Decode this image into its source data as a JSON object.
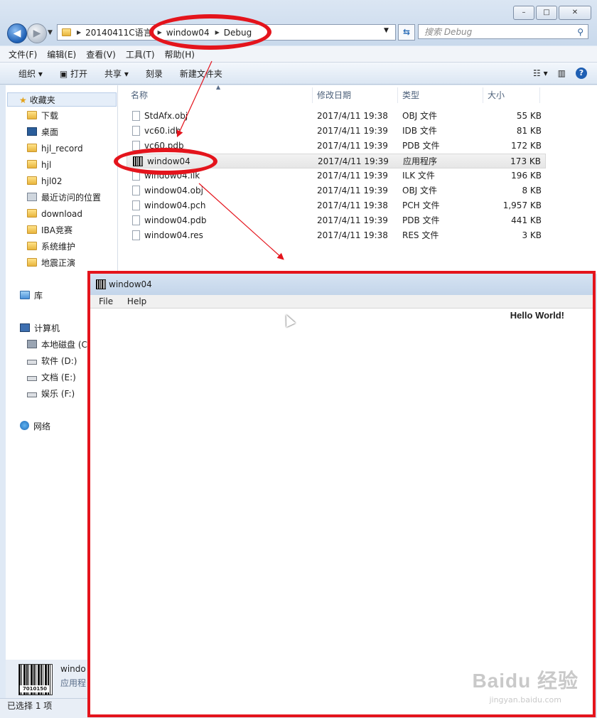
{
  "window": {
    "controls": [
      "–",
      "□",
      "✕"
    ]
  },
  "address": {
    "segments": [
      "20140411C语言",
      "window04",
      "Debug"
    ],
    "search_placeholder": "搜索 Debug"
  },
  "menu": [
    "文件(F)",
    "编辑(E)",
    "查看(V)",
    "工具(T)",
    "帮助(H)"
  ],
  "toolbar": {
    "organize": "组织 ▾",
    "open": "打开",
    "share": "共享 ▾",
    "burn": "刻录",
    "new_folder": "新建文件夹"
  },
  "nav": {
    "favorites": "收藏夹",
    "fav_items": [
      "下载",
      "桌面",
      "hjl_record",
      "hjl",
      "hjl02",
      "最近访问的位置",
      "download",
      "IBA竞赛",
      "系统维护",
      "地震正演"
    ],
    "library": "库",
    "computer": "计算机",
    "drives": [
      "本地磁盘 (C",
      "软件 (D:)",
      "文档 (E:)",
      "娱乐 (F:)"
    ],
    "network": "网络"
  },
  "columns": {
    "name": "名称",
    "date": "修改日期",
    "type": "类型",
    "size": "大小"
  },
  "files": [
    {
      "name": "StdAfx.obj",
      "date": "2017/4/11 19:38",
      "type": "OBJ 文件",
      "size": "55 KB",
      "icon": "document-icon"
    },
    {
      "name": "vc60.idb",
      "date": "2017/4/11 19:39",
      "type": "IDB 文件",
      "size": "81 KB",
      "icon": "document-icon"
    },
    {
      "name": "vc60.pdb",
      "date": "2017/4/11 19:39",
      "type": "PDB 文件",
      "size": "172 KB",
      "icon": "document-icon"
    },
    {
      "name": "window04",
      "date": "2017/4/11 19:39",
      "type": "应用程序",
      "size": "173 KB",
      "icon": "executable-icon"
    },
    {
      "name": "window04.ilk",
      "date": "2017/4/11 19:39",
      "type": "ILK 文件",
      "size": "196 KB",
      "icon": "document-icon"
    },
    {
      "name": "window04.obj",
      "date": "2017/4/11 19:39",
      "type": "OBJ 文件",
      "size": "8 KB",
      "icon": "document-icon"
    },
    {
      "name": "window04.pch",
      "date": "2017/4/11 19:38",
      "type": "PCH 文件",
      "size": "1,957 KB",
      "icon": "document-icon"
    },
    {
      "name": "window04.pdb",
      "date": "2017/4/11 19:39",
      "type": "PDB 文件",
      "size": "441 KB",
      "icon": "document-icon"
    },
    {
      "name": "window04.res",
      "date": "2017/4/11 19:38",
      "type": "RES 文件",
      "size": "3 KB",
      "icon": "document-icon"
    }
  ],
  "details": {
    "name": "windo",
    "type": "应用程",
    "barcode_text": "7010150"
  },
  "status": "已选择 1 项",
  "child_window": {
    "title": "window04",
    "menu": [
      "File",
      "Help"
    ],
    "text": "Hello World!"
  },
  "watermark": {
    "line1": "Baidu 经验",
    "line2": "jingyan.baidu.com"
  },
  "annotation_color": "#e4141c"
}
